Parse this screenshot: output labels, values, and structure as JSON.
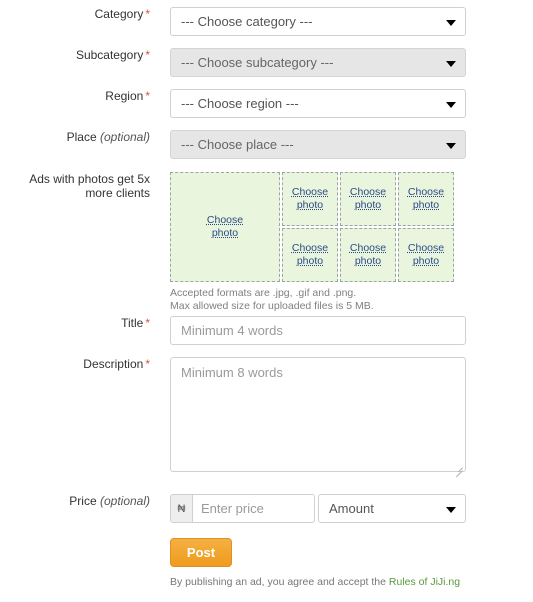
{
  "form": {
    "fields": [
      {
        "label": "Category",
        "required": true,
        "optional": false,
        "value": "--- Choose category ---",
        "state": "enabled"
      },
      {
        "label": "Subcategory",
        "required": true,
        "optional": false,
        "value": "--- Choose subcategory ---",
        "state": "disabled"
      },
      {
        "label": "Region",
        "required": true,
        "optional": false,
        "value": "--- Choose region ---",
        "state": "enabled"
      },
      {
        "label": "Place",
        "required": false,
        "optional": true,
        "value": "--- Choose place ---",
        "state": "disabled"
      }
    ],
    "photos": {
      "label": "Ads with photos get 5x more clients",
      "choose_label_line1": "Choose",
      "choose_label_line2": "photo",
      "note_line1": "Accepted formats are .jpg, .gif and .png.",
      "note_line2": "Max allowed size for uploaded files is 5 MB."
    },
    "title": {
      "label": "Title",
      "required_mark": "*",
      "placeholder": "Minimum 4 words",
      "value": ""
    },
    "description": {
      "label": "Description",
      "required_mark": "*",
      "placeholder": "Minimum 8 words",
      "value": ""
    },
    "price": {
      "label": "Price",
      "optional_text": "(optional)",
      "currency_symbol": "₦",
      "placeholder": "Enter price",
      "value": "",
      "amount_value": "Amount"
    },
    "submit": {
      "post_label": "Post",
      "terms_prefix": "By publishing an ad, you agree and accept the ",
      "terms_link": "Rules of JiJi.ng"
    },
    "required_mark": "*",
    "optional_text": "(optional)",
    "colors": {
      "accent_orange": "#ef9b1e",
      "required_red": "#d9534f",
      "photo_green_bg": "#e9f5dc",
      "link_green": "#5a9a3c",
      "choose_link_blue": "#2b4a8b"
    }
  }
}
